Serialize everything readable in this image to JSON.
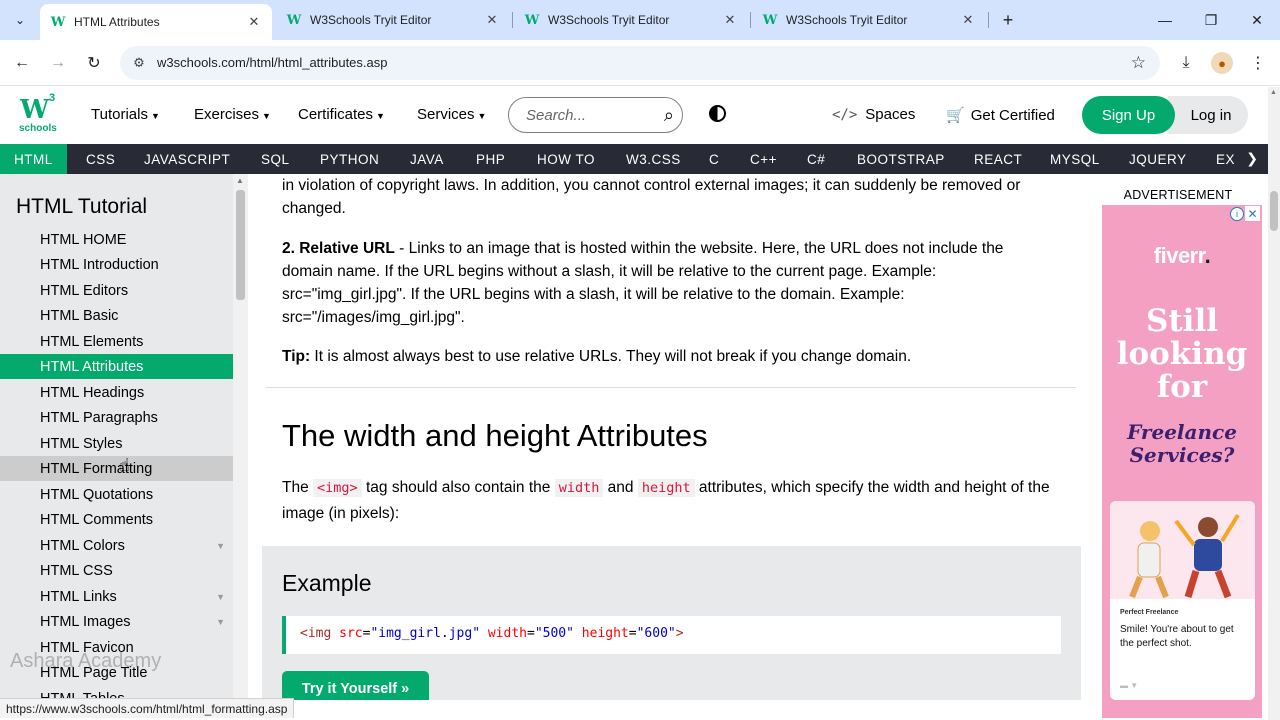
{
  "browser": {
    "tabs": [
      {
        "title": "HTML Attributes",
        "active": true
      },
      {
        "title": "W3Schools Tryit Editor",
        "active": false
      },
      {
        "title": "W3Schools Tryit Editor",
        "active": false
      },
      {
        "title": "W3Schools Tryit Editor",
        "active": false
      }
    ],
    "url": "w3schools.com/html/html_attributes.asp",
    "status_url": "https://www.w3schools.com/html/html_formatting.asp"
  },
  "header": {
    "logo_main": "W",
    "logo_sup": "3",
    "logo_sub": "schools",
    "menus": [
      "Tutorials",
      "Exercises",
      "Certificates",
      "Services"
    ],
    "search_placeholder": "Search...",
    "spaces": "Spaces",
    "get_certified": "Get Certified",
    "sign_up": "Sign Up",
    "log_in": "Log in"
  },
  "topnav": [
    "HTML",
    "CSS",
    "JAVASCRIPT",
    "SQL",
    "PYTHON",
    "JAVA",
    "PHP",
    "HOW TO",
    "W3.CSS",
    "C",
    "C++",
    "C#",
    "BOOTSTRAP",
    "REACT",
    "MYSQL",
    "JQUERY",
    "EX"
  ],
  "sidebar": {
    "title": "HTML Tutorial",
    "items": [
      "HTML HOME",
      "HTML Introduction",
      "HTML Editors",
      "HTML Basic",
      "HTML Elements",
      "HTML Attributes",
      "HTML Headings",
      "HTML Paragraphs",
      "HTML Styles",
      "HTML Formatting",
      "HTML Quotations",
      "HTML Comments",
      "HTML Colors",
      "HTML CSS",
      "HTML Links",
      "HTML Images",
      "HTML Favicon",
      "HTML Page Title",
      "HTML Tables"
    ],
    "active_item": "HTML Attributes",
    "hover_item": "HTML Formatting"
  },
  "content": {
    "p1": "in violation of copyright laws. In addition, you cannot control external images; it can suddenly be removed or changed.",
    "relative_label": "2. Relative URL",
    "relative_text": " - Links to an image that is hosted within the website. Here, the URL does not include the domain name. If the URL begins without a slash, it will be relative to the current page. Example: src=\"img_girl.jpg\". If the URL begins with a slash, it will be relative to the domain. Example: src=\"/images/img_girl.jpg\".",
    "tip_label": "Tip:",
    "tip_text": " It is almost always best to use relative URLs. They will not break if you change domain.",
    "heading": "The width and height Attributes",
    "p_the": "The ",
    "code_img": "<img>",
    "p_mid1": " tag should also contain the ",
    "code_width": "width",
    "p_and": " and ",
    "code_height": "height",
    "p_end": " attributes, which specify the width and height of the image (in pixels):",
    "example_title": "Example",
    "code": {
      "tag_open": "<img",
      "attr1": "src",
      "val1": "\"img_girl.jpg\"",
      "attr2": "width",
      "val2": "\"500\"",
      "attr3": "height",
      "val3": "\"600\"",
      "tag_close": ">"
    },
    "try_button": "Try it Yourself »"
  },
  "ad": {
    "label": "ADVERTISEMENT",
    "brand": "fiverr",
    "brand_dot": ".",
    "headline": "Still looking for",
    "subline": "Freelance Services?",
    "card_brand": "Perfect Freelance",
    "card_message": "Smile! You're about to get the perfect shot."
  },
  "watermark": "Ashara Academy",
  "colors": {
    "accent": "#04aa6d",
    "nav_dark": "#282a35",
    "sidebar_bg": "#e7e9eb",
    "ad_bg": "#f3a0c2"
  }
}
